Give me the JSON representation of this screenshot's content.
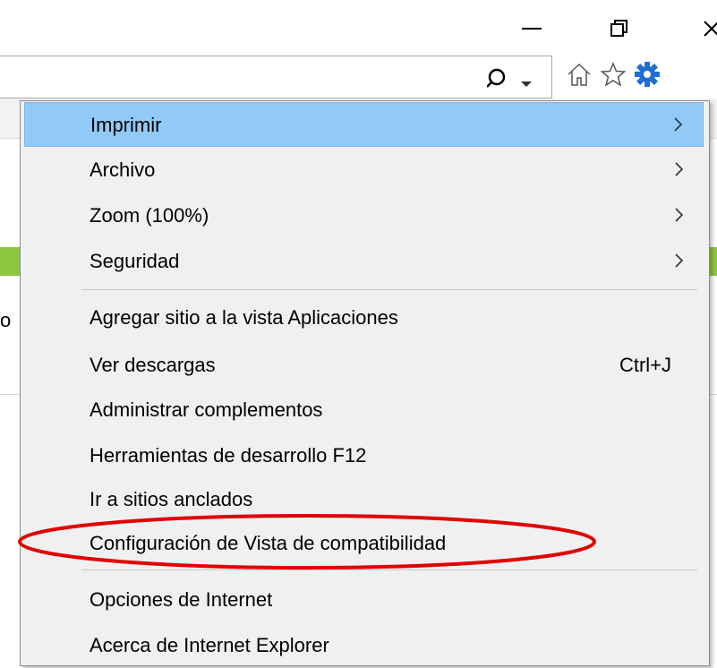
{
  "window_controls": {
    "minimize_icon": "minimize-icon",
    "restore_icon": "restore-icon",
    "close_icon": "close-icon"
  },
  "toolbar": {
    "icons": [
      "search-icon",
      "home-icon",
      "favorites-star-icon",
      "settings-gear-icon"
    ],
    "gear_color": "#1f6fd1"
  },
  "page": {
    "fragment_text": "o",
    "accent_bar_color": "#8dc63f"
  },
  "menu": {
    "items": [
      {
        "label": "Imprimir",
        "submenu": true,
        "highlighted": true
      },
      {
        "label": "Archivo",
        "submenu": true
      },
      {
        "label": "Zoom (100%)",
        "submenu": true
      },
      {
        "label": "Seguridad",
        "submenu": true
      },
      {
        "label": "Agregar sitio a la vista Aplicaciones"
      },
      {
        "label": "Ver descargas",
        "shortcut": "Ctrl+J"
      },
      {
        "label": "Administrar complementos"
      },
      {
        "label": "Herramientas de desarrollo F12"
      },
      {
        "label": "Ir a sitios anclados"
      },
      {
        "label": "Configuración de Vista de compatibilidad",
        "annotated": true
      },
      {
        "label": "Opciones de Internet"
      },
      {
        "label": "Acerca de Internet Explorer"
      }
    ],
    "highlight_color": "#91c9f7",
    "annotation_color": "#e00000"
  }
}
